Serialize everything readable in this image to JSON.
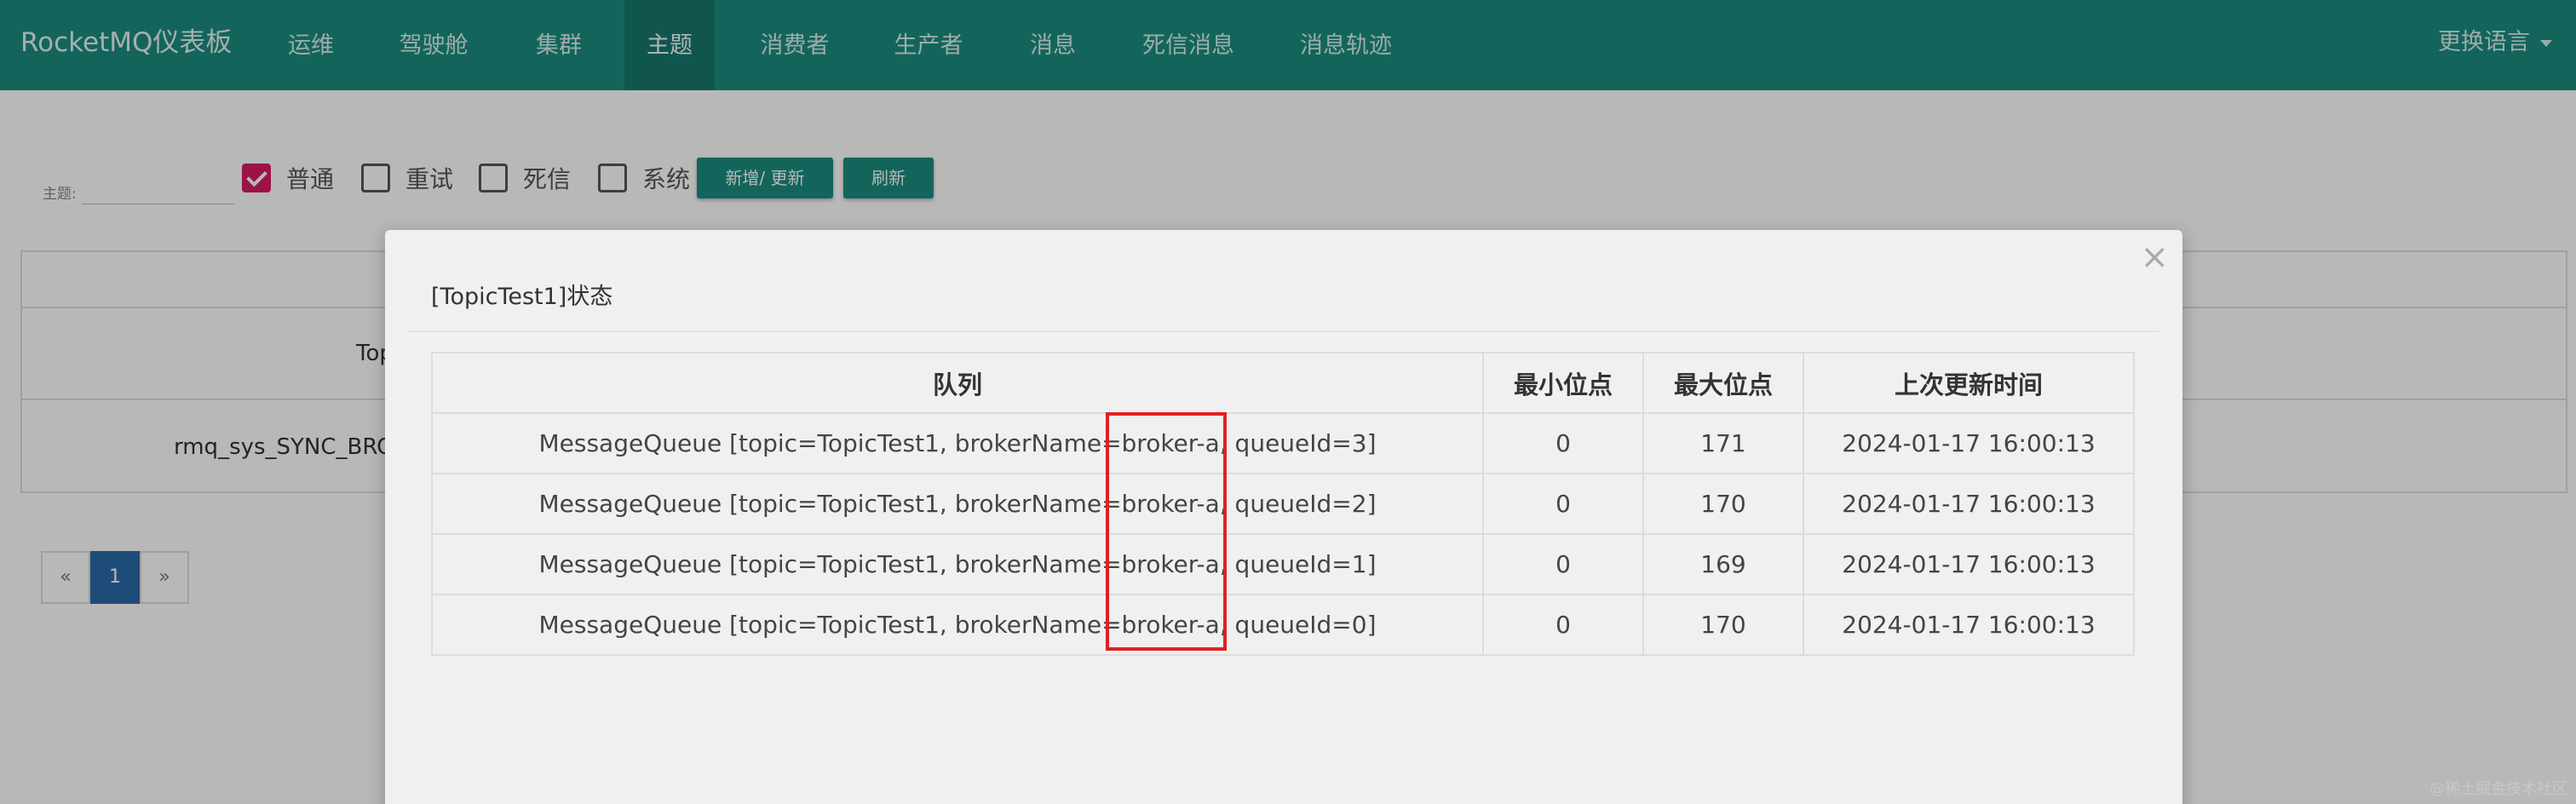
{
  "navbar": {
    "brand": "RocketMQ仪表板",
    "items": [
      "运维",
      "驾驶舱",
      "集群",
      "主题",
      "消费者",
      "生产者",
      "消息",
      "死信消息",
      "消息轨迹"
    ],
    "active_item": "主题",
    "language": "更换语言"
  },
  "filters": {
    "topic_label": "主题:",
    "checkboxes": [
      {
        "label": "普通",
        "checked": true
      },
      {
        "label": "重试",
        "checked": false
      },
      {
        "label": "死信",
        "checked": false
      },
      {
        "label": "系统",
        "checked": false
      }
    ],
    "add_update_button": "新增/ 更新",
    "refresh_button": "刷新"
  },
  "background_table": {
    "rows": [
      "Top",
      "rmq_sys_SYNC_BRC"
    ]
  },
  "pagination": {
    "prev": "«",
    "current": "1",
    "next": "»"
  },
  "modal": {
    "title": "[TopicTest1]状态",
    "close": "×",
    "columns": [
      "队列",
      "最小位点",
      "最大位点",
      "上次更新时间"
    ],
    "rows": [
      {
        "queue": "MessageQueue [topic=TopicTest1, brokerName=broker-a, queueId=3]",
        "min": "0",
        "max": "171",
        "updated": "2024-01-17 16:00:13"
      },
      {
        "queue": "MessageQueue [topic=TopicTest1, brokerName=broker-a, queueId=2]",
        "min": "0",
        "max": "170",
        "updated": "2024-01-17 16:00:13"
      },
      {
        "queue": "MessageQueue [topic=TopicTest1, brokerName=broker-a, queueId=1]",
        "min": "0",
        "max": "169",
        "updated": "2024-01-17 16:00:13"
      },
      {
        "queue": "MessageQueue [topic=TopicTest1, brokerName=broker-a, queueId=0]",
        "min": "0",
        "max": "170",
        "updated": "2024-01-17 16:00:13"
      }
    ]
  },
  "watermark": "@稀土掘金技术社区",
  "colors": {
    "primary": "#1b8c7f",
    "checkbox": "#d81b60",
    "highlight": "#e02020",
    "pager_active": "#2a6aa8"
  }
}
